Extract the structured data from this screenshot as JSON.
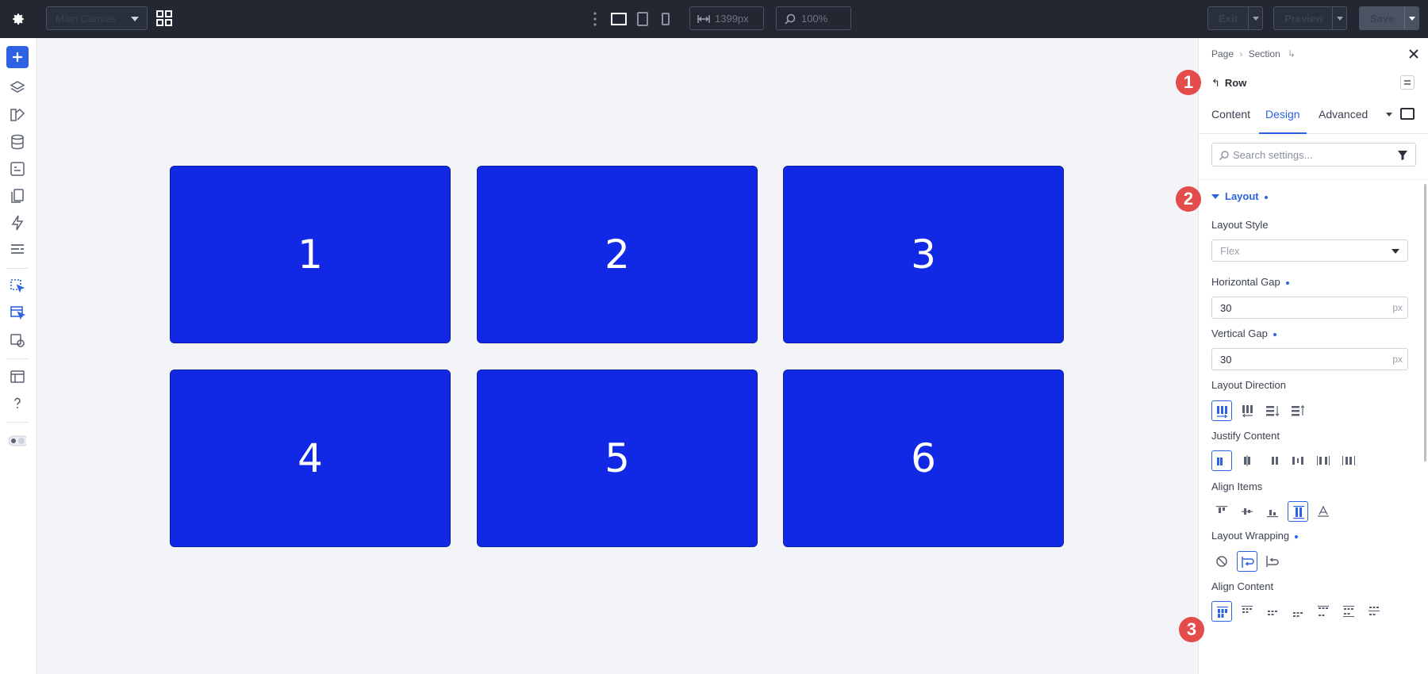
{
  "topbar": {
    "canvas_select": "Main Canvas",
    "width_value": "1399px",
    "zoom_value": "100%",
    "exit_label": "Exit",
    "preview_label": "Preview",
    "save_label": "Save"
  },
  "canvas": {
    "boxes": [
      "1",
      "2",
      "3",
      "4",
      "5",
      "6"
    ],
    "box_color": "#1129e4"
  },
  "panel": {
    "breadcrumb_page": "Page",
    "breadcrumb_section": "Section",
    "element_name": "Row",
    "tabs": [
      "Content",
      "Design",
      "Advanced"
    ],
    "active_tab": "Design",
    "search_placeholder": "Search settings...",
    "section_title": "Layout",
    "fields": {
      "layout_style_label": "Layout Style",
      "layout_style_value": "Flex",
      "horizontal_gap_label": "Horizontal Gap",
      "horizontal_gap_value": "30",
      "horizontal_gap_unit": "px",
      "vertical_gap_label": "Vertical Gap",
      "vertical_gap_value": "30",
      "vertical_gap_unit": "px",
      "layout_direction_label": "Layout Direction",
      "justify_content_label": "Justify Content",
      "align_items_label": "Align Items",
      "layout_wrapping_label": "Layout Wrapping",
      "align_content_label": "Align Content"
    },
    "accent_color": "#2d63e2"
  },
  "annotations": [
    "1",
    "2",
    "3"
  ],
  "annotation_color": "#e44b4b"
}
